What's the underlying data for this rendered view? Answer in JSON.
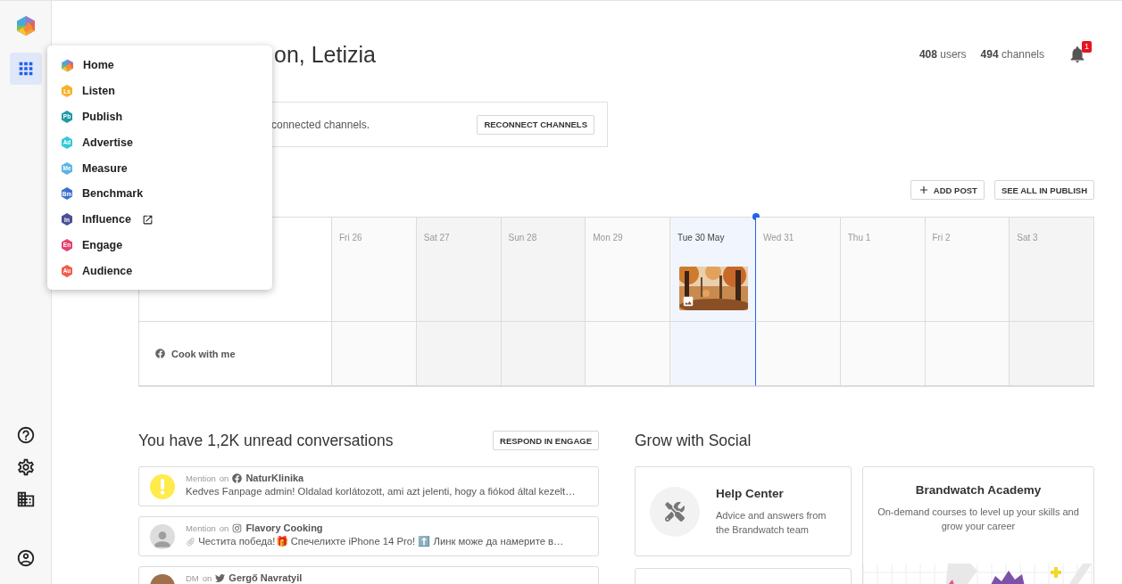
{
  "sidebar": {
    "apps_open": true,
    "bottom_icons": [
      {
        "kind": "help"
      },
      {
        "kind": "settings"
      },
      {
        "kind": "company"
      },
      {
        "kind": "account"
      }
    ]
  },
  "apps_menu": [
    {
      "label": "Home",
      "kind": "home",
      "external": false
    },
    {
      "label": "Listen",
      "abbr": "Ls",
      "color": "#f6b12c",
      "kind": "app",
      "external": false
    },
    {
      "label": "Publish",
      "abbr": "Pb",
      "color": "#1f9aa5",
      "kind": "app",
      "external": false
    },
    {
      "label": "Advertise",
      "abbr": "Ad",
      "color": "#33c9d6",
      "kind": "app",
      "external": false
    },
    {
      "label": "Measure",
      "abbr": "Me",
      "color": "#59b4e3",
      "kind": "app",
      "external": false
    },
    {
      "label": "Benchmark",
      "abbr": "Bm",
      "color": "#3d6fd1",
      "kind": "app",
      "external": false
    },
    {
      "label": "Influence",
      "abbr": "In",
      "color": "#4b4f96",
      "kind": "app",
      "external": true
    },
    {
      "label": "Engage",
      "abbr": "En",
      "color": "#e2436e",
      "kind": "app",
      "external": false
    },
    {
      "label": "Audience",
      "abbr": "Au",
      "color": "#f25c4c",
      "kind": "app",
      "external": false
    }
  ],
  "header": {
    "title": "on, Letizia",
    "stats": [
      "**408** users",
      "**494** channels"
    ],
    "notification_count": "1"
  },
  "alert": {
    "text": "connected channels.",
    "button": "RECONNECT CHANNELS"
  },
  "calendar": {
    "buttons": [
      {
        "label": "ADD POST",
        "kind": "add"
      },
      {
        "label": "SEE ALL IN PUBLISH",
        "kind": "plain"
      }
    ],
    "days": [
      {
        "label": "Fri 26",
        "kind": "weekday"
      },
      {
        "label": "Sat 27",
        "kind": "weekend"
      },
      {
        "label": "Sun 28",
        "kind": "weekend"
      },
      {
        "label": "Mon 29",
        "kind": "weekday"
      },
      {
        "label": "Tue 30 May",
        "kind": "today"
      },
      {
        "label": "Wed 31",
        "kind": "weekday"
      },
      {
        "label": "Thu 1",
        "kind": "weekday"
      },
      {
        "label": "Fri 2",
        "kind": "weekday"
      },
      {
        "label": "Sat 3",
        "kind": "weekend"
      }
    ],
    "rows": [
      {
        "posts": [
          false,
          false,
          false,
          false,
          true,
          false,
          false,
          false,
          false
        ]
      },
      {
        "channel": "Cook with me",
        "network": {
          "kind": "facebook"
        },
        "posts": [
          false,
          false,
          false,
          false,
          false,
          false,
          false,
          false,
          false
        ]
      }
    ]
  },
  "conversations": {
    "title": "You have 1,2K unread conversations",
    "button": "RESPOND IN ENGAGE",
    "items": [
      {
        "type": "Mention",
        "connector": "on",
        "network": {
          "kind": "facebook"
        },
        "name": "NaturKlinika",
        "avatar": {
          "kind": "warning"
        },
        "attachment": false,
        "text": "Kedves Fanpage admin! Oldalad korlátozott, ami azt jelenti, hogy a fiókod által kezelt…"
      },
      {
        "type": "Mention",
        "connector": "on",
        "network": {
          "kind": "instagram"
        },
        "name": "Flavory Cooking",
        "avatar": {
          "kind": "person"
        },
        "attachment": true,
        "text": "Честита победа!🎁 Спечелихте iPhone 14 Pro! ⬆️ Линк може да намерите в…"
      },
      {
        "type": "DM",
        "connector": "on",
        "network": {
          "kind": "twitter"
        },
        "name": "Gergő Navratyil"
      }
    ]
  },
  "grow": {
    "title": "Grow with Social",
    "help": {
      "title": "Help Center",
      "text": "Advice and answers from the Brandwatch team"
    },
    "academy": {
      "title": "Brandwatch Academy",
      "text": "On-demand courses to level up your skills and grow your career"
    }
  }
}
